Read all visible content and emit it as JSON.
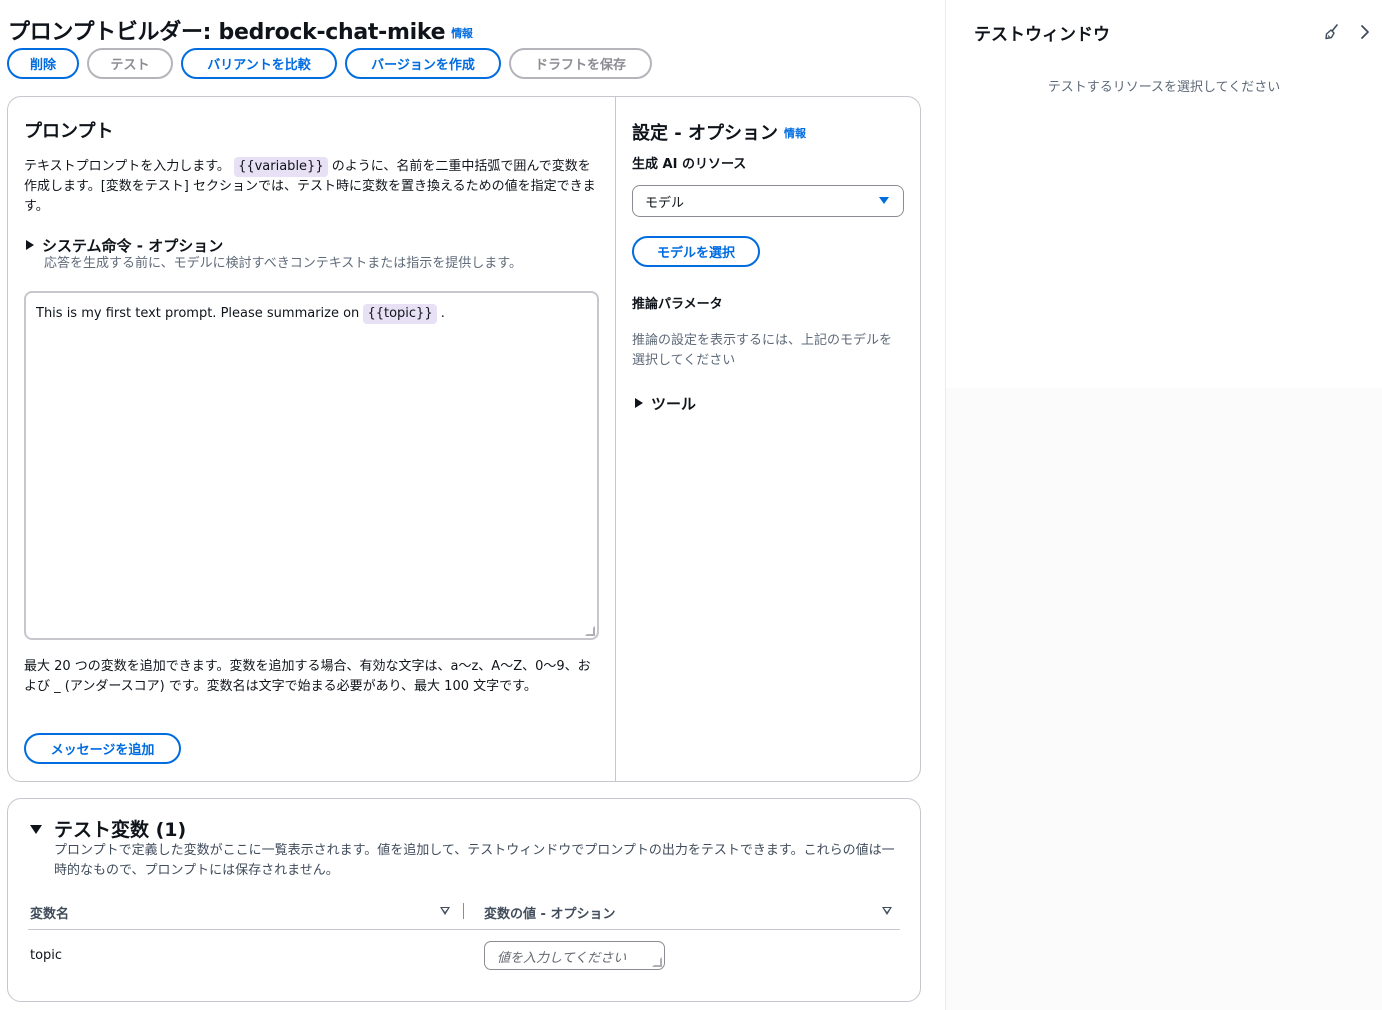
{
  "header": {
    "title": "プロンプトビルダー: bedrock-chat-mike",
    "info": "情報"
  },
  "toolbar": {
    "delete": "削除",
    "test": "テスト",
    "compare_variants": "バリアントを比較",
    "create_version": "バージョンを作成",
    "save_draft": "ドラフトを保存"
  },
  "prompt": {
    "title": "プロンプト",
    "desc_prefix": "テキストプロンプトを入力します。",
    "desc_pill": "{{variable}}",
    "desc_suffix": "のように、名前を二重中括弧で囲んで変数を作成します。[変数をテスト] セクションでは、テスト時に変数を置き換えるための値を指定できます。",
    "system_title": "システム命令 - オプション",
    "system_desc": "応答を生成する前に、モデルに検討すべきコンテキストまたは指示を提供します。",
    "text_before": "This is my first text prompt. Please summarize on",
    "text_var": "{{topic}}",
    "text_after": ".",
    "limits": "最大 20 つの変数を追加できます。変数を追加する場合、有効な文字は、a〜z、A〜Z、0〜9、および _ (アンダースコア) です。変数名は文字で始まる必要があり、最大 100 文字です。",
    "add_message": "メッセージを追加"
  },
  "settings": {
    "title": "設定 - オプション",
    "info": "情報",
    "resource_label": "生成 AI のリソース",
    "resource_value": "モデル",
    "select_model": "モデルを選択",
    "inference_title": "推論パラメータ",
    "inference_desc": "推論の設定を表示するには、上記のモデルを選択してください",
    "tools": "ツール"
  },
  "test_vars": {
    "title": "テスト変数 (1)",
    "desc": "プロンプトで定義した変数がここに一覧表示されます。値を追加して、テストウィンドウでプロンプトの出力をテストできます。これらの値は一時的なもので、プロンプトには保存されません。",
    "col_name": "変数名",
    "col_value": "変数の値 - オプション",
    "rows": [
      {
        "name": "topic",
        "placeholder": "値を入力してください"
      }
    ]
  },
  "test_window": {
    "title": "テストウィンドウ",
    "empty": "テストするリソースを選択してください"
  },
  "colors": {
    "accent": "#006ce0",
    "border": "#c6c6cd",
    "variable_bg": "#e8e0f5"
  }
}
